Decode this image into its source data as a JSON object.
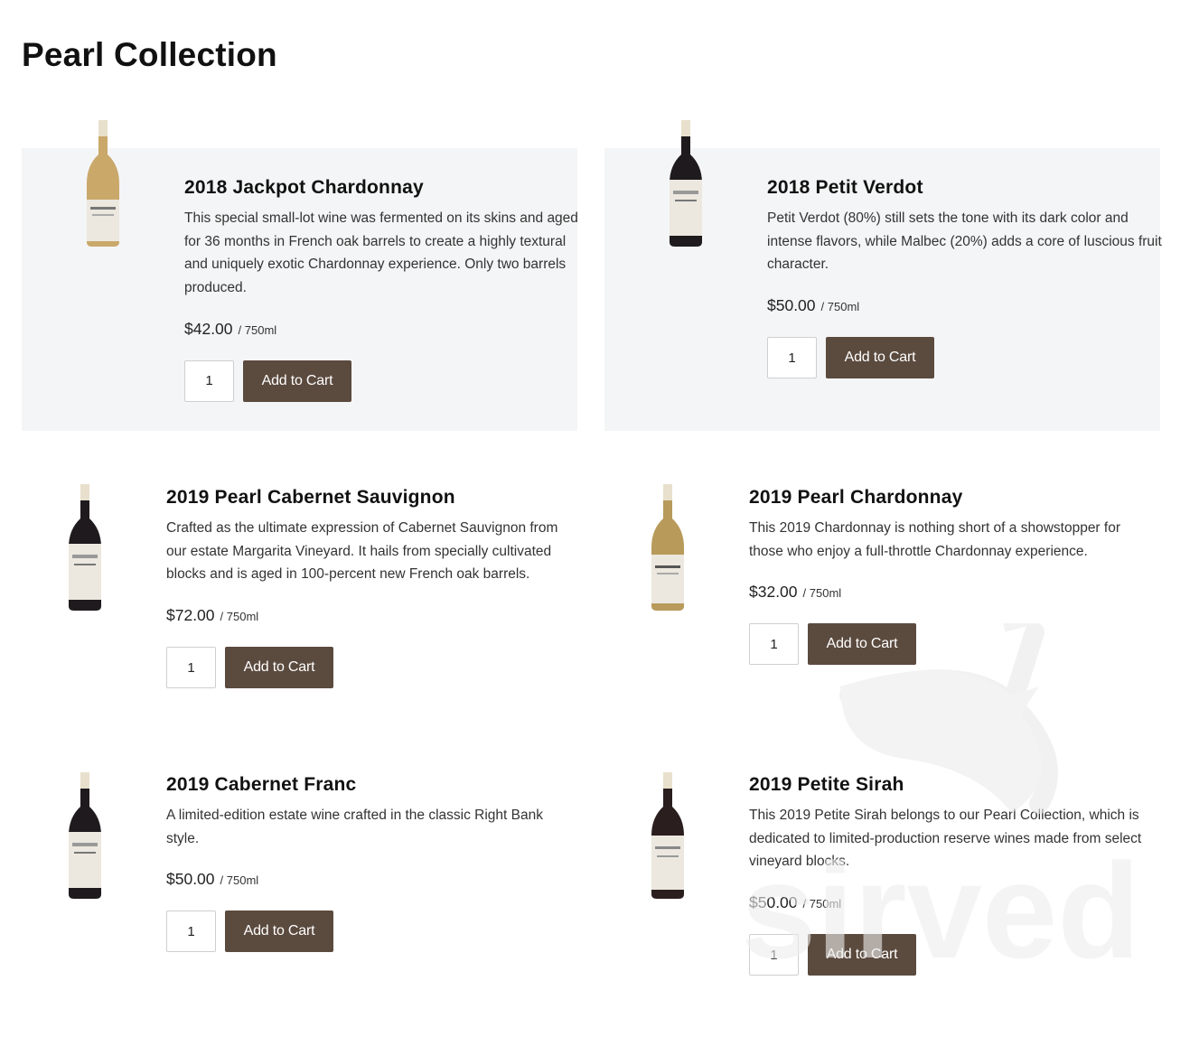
{
  "page": {
    "title": "Pearl Collection"
  },
  "watermark": {
    "text": "sirved"
  },
  "products": [
    {
      "name": "2018 Jackpot Chardonnay",
      "description": "This special small-lot wine was fermented on its skins and aged for 36 months in French oak barrels to create a highly textural and uniquely exotic Chardonnay experience. Only two barrels produced.",
      "price": "$42.00",
      "unit": "/ 750ml",
      "quantity": "1",
      "button": "Add to Cart",
      "bottle_color": "#c9a86a"
    },
    {
      "name": "2018 Petit Verdot",
      "description": "Petit Verdot (80%) still sets the tone with its dark color and intense flavors, while Malbec (20%) adds a core of luscious fruit character.",
      "price": "$50.00",
      "unit": "/ 750ml",
      "quantity": "1",
      "button": "Add to Cart",
      "bottle_color": "#1e1a1d"
    },
    {
      "name": "2019 Pearl Cabernet Sauvignon",
      "description": "Crafted as the ultimate expression of Cabernet Sauvignon from our estate Margarita Vineyard. It hails from specially cultivated blocks and is aged in 100-percent new French oak barrels.",
      "price": "$72.00",
      "unit": "/ 750ml",
      "quantity": "1",
      "button": "Add to Cart",
      "bottle_color": "#1e1a1d"
    },
    {
      "name": "2019 Pearl Chardonnay",
      "description": "This 2019 Chardonnay is nothing short of a showstopper for those who enjoy a full-throttle Chardonnay experience.",
      "price": "$32.00",
      "unit": "/ 750ml",
      "quantity": "1",
      "button": "Add to Cart",
      "bottle_color": "#b89a5a"
    },
    {
      "name": "2019 Cabernet Franc",
      "description": "A limited-edition estate wine crafted in the classic Right Bank style.",
      "price": "$50.00",
      "unit": "/ 750ml",
      "quantity": "1",
      "button": "Add to Cart",
      "bottle_color": "#1e1a1d"
    },
    {
      "name": "2019 Petite Sirah",
      "description": "This 2019 Petite Sirah belongs to our Pearl Collection, which is dedicated to limited-production reserve wines made from select vineyard blocks.",
      "price": "$50.00",
      "unit": "/ 750ml",
      "quantity": "1",
      "button": "Add to Cart",
      "bottle_color": "#2a1e1e"
    }
  ],
  "colors": {
    "button_bg": "#5b4a3e",
    "card_bg": "#f4f5f6"
  }
}
